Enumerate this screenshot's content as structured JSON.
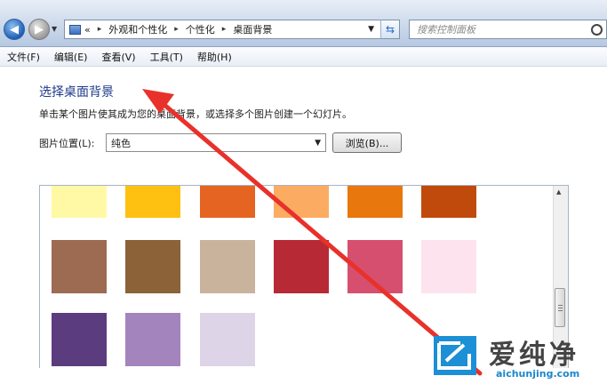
{
  "window": {
    "nav": {
      "back_glyph": "◀",
      "forward_glyph": "▶"
    },
    "address": {
      "prefix": "«",
      "breadcrumbs": [
        "外观和个性化",
        "个性化",
        "桌面背景"
      ],
      "separator": "▸"
    },
    "search_placeholder": "搜索控制面板"
  },
  "menu": [
    "文件(F)",
    "编辑(E)",
    "查看(V)",
    "工具(T)",
    "帮助(H)"
  ],
  "page": {
    "title": "选择桌面背景",
    "subtitle": "单击某个图片使其成为您的桌面背景，或选择多个图片创建一个幻灯片。",
    "location_label": "图片位置(L):",
    "location_value": "纯色",
    "browse_label": "浏览(B)..."
  },
  "swatches": [
    [
      "#fff9a6",
      "#fec111",
      "#e66421",
      "#fcab62",
      "#e8770e",
      "#c04a0b"
    ],
    [
      "#9d6a52",
      "#8c6238",
      "#c9b39d",
      "#b72a35",
      "#d74f6f",
      "#fde3ee"
    ],
    [
      "#5b3c7f",
      "#a384bd",
      "#ddd4e8"
    ]
  ],
  "colors": {
    "arrow": "#e8312a",
    "title": "#1e3a8a",
    "watermark_blue": "#1a86cc"
  },
  "watermark": {
    "title": "爱纯净",
    "domain": "aichunjing.com"
  }
}
